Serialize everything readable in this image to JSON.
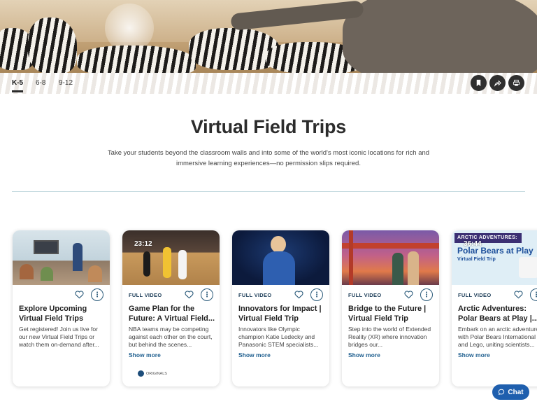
{
  "grade_tabs": [
    {
      "label": "K-5",
      "active": true
    },
    {
      "label": "6-8",
      "active": false
    },
    {
      "label": "9-12",
      "active": false
    }
  ],
  "actions": {
    "bookmark": "bookmark-icon",
    "share": "share-icon",
    "print": "print-icon"
  },
  "page": {
    "title": "Virtual Field Trips",
    "subtitle": "Take your students beyond the classroom walls and into some of the world's most iconic locations for rich and immersive learning experiences—no permission slips required."
  },
  "cards": [
    {
      "duration": "",
      "type": "",
      "title": "Explore Upcoming Virtual Field Trips",
      "description": "Get registered! Join us live for our new Virtual Field Trips or watch them on-demand after...",
      "show_more": "",
      "brand": ""
    },
    {
      "duration": "23:12",
      "type": "FULL VIDEO",
      "title": "Game Plan for the Future: A Virtual Field...",
      "description": "NBA teams may be competing against each other on the court, but behind the scenes...",
      "show_more": "Show more",
      "brand": "ORIGINALS"
    },
    {
      "duration": "",
      "type": "FULL VIDEO",
      "title": "Innovators for Impact | Virtual Field Trip",
      "description": "Innovators like Olympic champion Katie Ledecky and Panasonic STEM specialists...",
      "show_more": "Show more",
      "brand": ""
    },
    {
      "duration": "",
      "type": "FULL VIDEO",
      "title": "Bridge to the Future | Virtual Field Trip",
      "description": "Step into the world of Extended Reality (XR) where innovation bridges our...",
      "show_more": "Show more",
      "brand": ""
    },
    {
      "duration": "36:44",
      "type": "FULL VIDEO",
      "title": "Arctic Adventures: Polar Bears at Play |...",
      "description": "Embark on an arctic adventure with Polar Bears International and Lego, uniting scientists...",
      "show_more": "Show more",
      "brand": "",
      "thumb_banner": "ARCTIC ADVENTURES:",
      "thumb_headline": "Polar Bears at Play",
      "thumb_sub": "Virtual Field Trip"
    }
  ],
  "chat": {
    "label": "Chat"
  },
  "colors": {
    "accent_blue": "#1f5fae",
    "link_blue": "#1f5f8f",
    "divider": "#c9dde2"
  }
}
